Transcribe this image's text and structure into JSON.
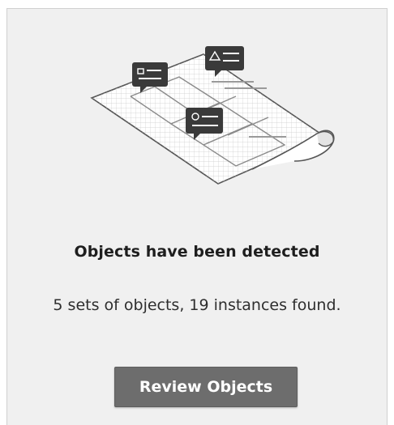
{
  "card": {
    "illustration_icon": "blueprint-with-callouts-icon",
    "title": "Objects have been detected",
    "message": "5 sets of objects, 19 instances found.",
    "review_button_label": "Review Objects"
  },
  "colors": {
    "panel_background": "#f0f0f0",
    "button_background": "#6d6d6d",
    "button_text": "#ffffff",
    "title_text": "#1e1e1e",
    "callout_fill": "#3a3a3a"
  }
}
